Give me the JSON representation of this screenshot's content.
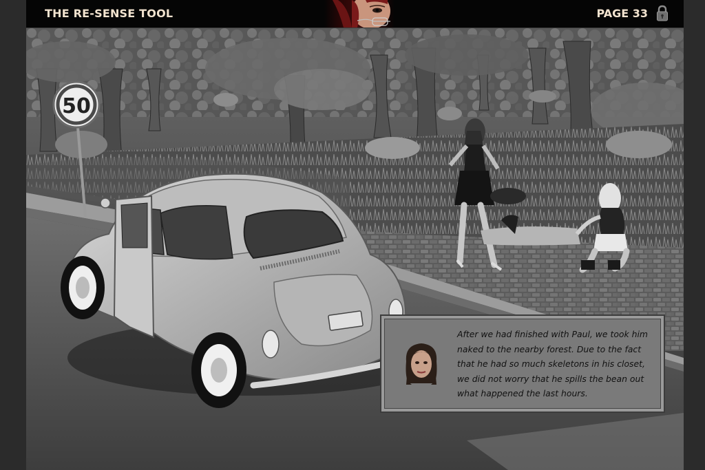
{
  "header": {
    "title": "THE RE-SENSE TOOL",
    "page_label": "PAGE 33",
    "lock_icon": "padlock-icon",
    "portrait": "narrator-portrait"
  },
  "scene": {
    "sign_text": "50",
    "description_icon": "speed-limit-sign-icon"
  },
  "dialogue": {
    "speaker_avatar": "speaker-portrait",
    "text": "After we had finished with Paul, we took him naked to the nearby forest. Due to the fact that he had so much skeletons in his closet, we did not worry that he spills the bean out what happened the last hours."
  },
  "colors": {
    "title_text": "#f2e3cf",
    "dialog_bg": "#7a7a7a",
    "dialog_border": "#3c3c3c"
  }
}
